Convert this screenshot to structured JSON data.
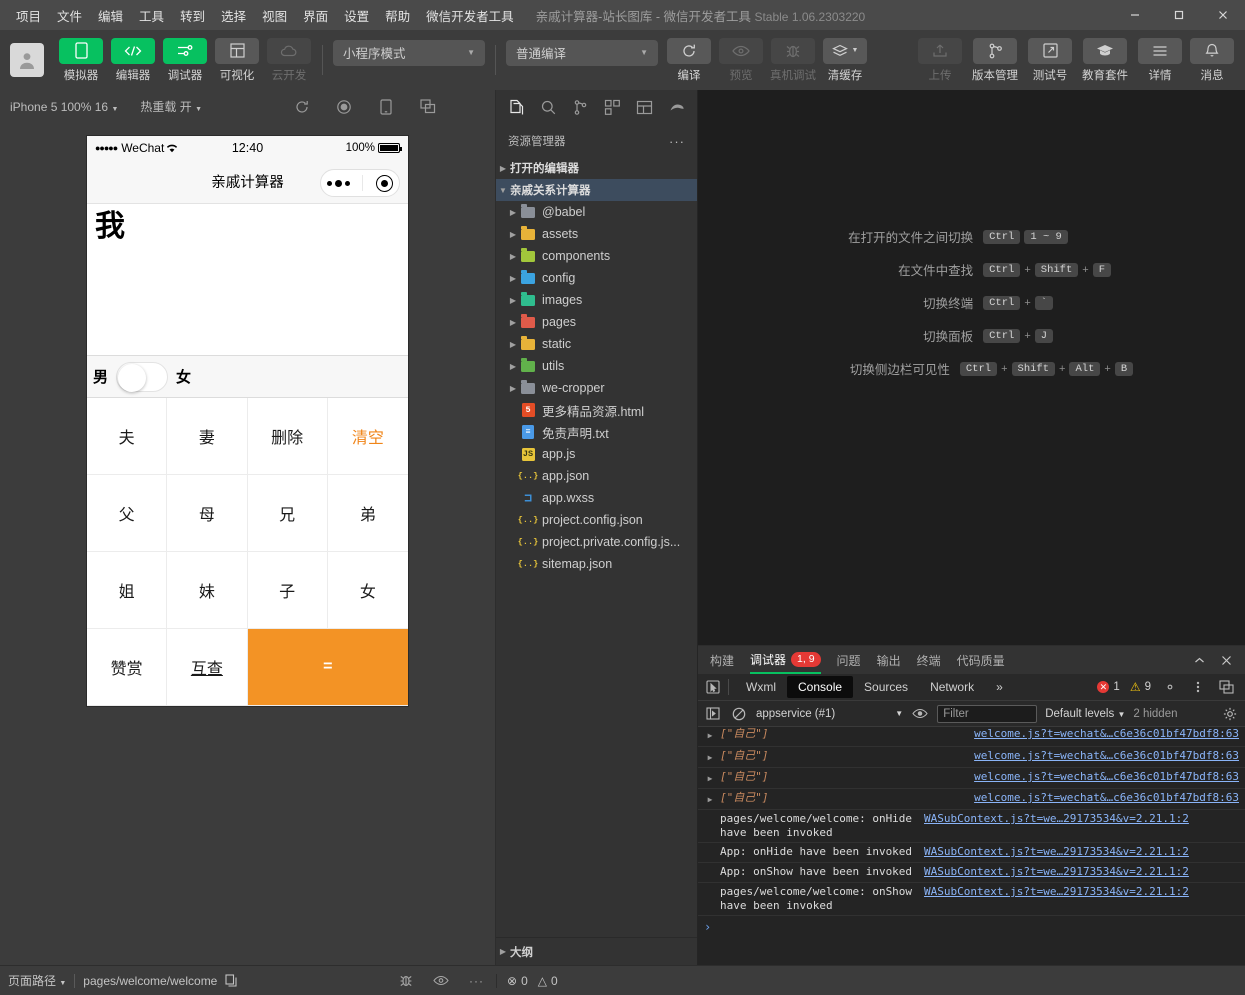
{
  "titlebar": {
    "menus": [
      "项目",
      "文件",
      "编辑",
      "工具",
      "转到",
      "选择",
      "视图",
      "界面",
      "设置",
      "帮助",
      "微信开发者工具"
    ],
    "document_title": "亲戚计算器-站长图库",
    "separator": " - ",
    "app_name": "微信开发者工具",
    "version": "Stable 1.06.2303220",
    "minimize": "—",
    "maximize": "▢",
    "close": "✕"
  },
  "toolbar": {
    "left_buttons": [
      {
        "label": "模拟器",
        "icon": "phone-icon",
        "state": "active"
      },
      {
        "label": "编辑器",
        "icon": "code-icon",
        "state": "active"
      },
      {
        "label": "调试器",
        "icon": "sliders-icon",
        "state": "active"
      },
      {
        "label": "可视化",
        "icon": "layout-icon",
        "state": "normal"
      },
      {
        "label": "云开发",
        "icon": "cloud-icon",
        "state": "disabled"
      }
    ],
    "mode_select": "小程序模式",
    "compile_select": "普通编译",
    "mid_buttons": [
      {
        "label": "编译",
        "icon": "refresh-icon",
        "state": "normal"
      },
      {
        "label": "预览",
        "icon": "eye-icon",
        "state": "disabled"
      },
      {
        "label": "真机调试",
        "icon": "bug-icon",
        "state": "disabled"
      },
      {
        "label": "清缓存",
        "icon": "layers-icon",
        "state": "normal"
      }
    ],
    "right_buttons": [
      {
        "label": "上传",
        "icon": "upload-icon",
        "state": "disabled"
      },
      {
        "label": "版本管理",
        "icon": "branch-icon",
        "state": "normal"
      },
      {
        "label": "测试号",
        "icon": "external-icon",
        "state": "normal"
      },
      {
        "label": "教育套件",
        "icon": "graduation-icon",
        "state": "normal"
      },
      {
        "label": "详情",
        "icon": "menu-icon",
        "state": "normal"
      },
      {
        "label": "消息",
        "icon": "bell-icon",
        "state": "normal"
      }
    ]
  },
  "simulator": {
    "device_select": "iPhone 5 100% 16",
    "hotreload_label": "热重载 开",
    "icons": [
      "rotate-icon",
      "record-icon",
      "device-icon",
      "popout-icon"
    ],
    "phone": {
      "status": {
        "dots": "●●●●●",
        "carrier": "WeChat",
        "wifi": "⌃",
        "time": "12:40",
        "battery_pct": "100%"
      },
      "nav_title": "亲戚计算器",
      "capsule": {
        "more": "•••",
        "target": "◉"
      },
      "expression": "我",
      "gender": {
        "male": "男",
        "female": "女",
        "value": "male"
      },
      "keys": [
        {
          "label": "夫",
          "style": "normal"
        },
        {
          "label": "妻",
          "style": "normal"
        },
        {
          "label": "删除",
          "style": "normal"
        },
        {
          "label": "清空",
          "style": "orange-text"
        },
        {
          "label": "父",
          "style": "normal"
        },
        {
          "label": "母",
          "style": "normal"
        },
        {
          "label": "兄",
          "style": "normal"
        },
        {
          "label": "弟",
          "style": "normal"
        },
        {
          "label": "姐",
          "style": "normal"
        },
        {
          "label": "妹",
          "style": "normal"
        },
        {
          "label": "子",
          "style": "normal"
        },
        {
          "label": "女",
          "style": "normal"
        },
        {
          "label": "赞赏",
          "style": "normal"
        },
        {
          "label": "互查",
          "style": "underline"
        },
        {
          "label": "=",
          "style": "equals"
        }
      ]
    }
  },
  "explorer": {
    "tabs": [
      "files-icon",
      "search-icon",
      "scm-icon",
      "extensions-icon",
      "debug-icon",
      "plugin-icon"
    ],
    "title": "资源管理器",
    "more": "···",
    "sections": [
      {
        "label": "打开的编辑器",
        "expanded": false
      },
      {
        "label": "亲戚关系计算器",
        "expanded": true,
        "highlight": true
      }
    ],
    "tree": [
      {
        "name": "@babel",
        "type": "folder",
        "color": "#8a8f98",
        "expandable": true
      },
      {
        "name": "assets",
        "type": "folder",
        "color": "#e8b339",
        "expandable": true
      },
      {
        "name": "components",
        "type": "folder",
        "color": "#a2c73b",
        "expandable": true
      },
      {
        "name": "config",
        "type": "folder",
        "color": "#3ba3e0",
        "expandable": true
      },
      {
        "name": "images",
        "type": "folder",
        "color": "#2fbd8e",
        "expandable": true
      },
      {
        "name": "pages",
        "type": "folder",
        "color": "#e05b4a",
        "expandable": true
      },
      {
        "name": "static",
        "type": "folder",
        "color": "#e8b339",
        "expandable": true
      },
      {
        "name": "utils",
        "type": "folder",
        "color": "#61b14b",
        "expandable": true
      },
      {
        "name": "we-cropper",
        "type": "folder",
        "color": "#8a8f98",
        "expandable": true
      },
      {
        "name": "更多精品资源.html",
        "type": "html",
        "color": "#e44d26",
        "icon_text": "5"
      },
      {
        "name": "免责声明.txt",
        "type": "txt",
        "color": "#4a9ae8",
        "icon_text": "≡"
      },
      {
        "name": "app.js",
        "type": "js",
        "color": "#e8c53a",
        "icon_text": "JS"
      },
      {
        "name": "app.json",
        "type": "json",
        "color": "#e8c53a",
        "icon_text": "{..}"
      },
      {
        "name": "app.wxss",
        "type": "wxss",
        "color": "#3d8fd6",
        "icon_text": "⌐"
      },
      {
        "name": "project.config.json",
        "type": "json",
        "color": "#e8c53a",
        "icon_text": "{..}"
      },
      {
        "name": "project.private.config.js...",
        "type": "json",
        "color": "#e8c53a",
        "icon_text": "{..}"
      },
      {
        "name": "sitemap.json",
        "type": "json",
        "color": "#e8c53a",
        "icon_text": "{..}"
      }
    ],
    "outline": "大纲"
  },
  "editor": {
    "shortcuts": [
      {
        "label": "在打开的文件之间切换",
        "keys": [
          "Ctrl",
          "1 ~ 9"
        ],
        "seps": [
          ""
        ]
      },
      {
        "label": "在文件中查找",
        "keys": [
          "Ctrl",
          "Shift",
          "F"
        ],
        "seps": [
          "+",
          "+"
        ]
      },
      {
        "label": "切换终端",
        "keys": [
          "Ctrl",
          "`"
        ],
        "seps": [
          "+"
        ]
      },
      {
        "label": "切换面板",
        "keys": [
          "Ctrl",
          "J"
        ],
        "seps": [
          "+"
        ]
      },
      {
        "label": "切换侧边栏可见性",
        "keys": [
          "Ctrl",
          "Shift",
          "Alt",
          "B"
        ],
        "seps": [
          "+",
          "+",
          "+"
        ]
      }
    ]
  },
  "debugger": {
    "panel_tabs": [
      {
        "label": "构建",
        "active": false
      },
      {
        "label": "调试器",
        "active": true,
        "badge": "1, 9"
      },
      {
        "label": "问题",
        "active": false
      },
      {
        "label": "输出",
        "active": false
      },
      {
        "label": "终端",
        "active": false
      },
      {
        "label": "代码质量",
        "active": false
      }
    ],
    "collapse_icon": "chevron-up-icon",
    "close_icon": "close-icon",
    "devtools_tabs": [
      {
        "label": "Wxml",
        "active": false
      },
      {
        "label": "Console",
        "active": true
      },
      {
        "label": "Sources",
        "active": false
      },
      {
        "label": "Network",
        "active": false
      },
      {
        "label": "»",
        "active": false
      }
    ],
    "inspect_icon": "inspect-icon",
    "error_count": "1",
    "warning_count": "9",
    "settings_icon": "gear-icon",
    "kebab_icon": "kebab-icon",
    "dock_icon": "dock-icon",
    "console_bar": {
      "sidebar_icon": "console-sidebar-icon",
      "clear_icon": "clear-icon",
      "context": "appservice (#1)",
      "eye_icon": "eye-icon",
      "filter_placeholder": "Filter",
      "levels": "Default levels",
      "hidden": "2 hidden",
      "settings_icon": "gear-icon"
    },
    "logs": [
      {
        "kind": "array",
        "text": "[\"自己\"]",
        "source": "welcome.js?t=wechat&…c6e36c01bf47bdf8:63"
      },
      {
        "kind": "array",
        "text": "[\"自己\"]",
        "source": "welcome.js?t=wechat&…c6e36c01bf47bdf8:63"
      },
      {
        "kind": "array",
        "text": "[\"自己\"]",
        "source": "welcome.js?t=wechat&…c6e36c01bf47bdf8:63"
      },
      {
        "kind": "text",
        "text": "pages/welcome/welcome: onHide have been invoked",
        "source": "WASubContext.js?t=we…29173534&v=2.21.1:2"
      },
      {
        "kind": "text",
        "text": "App: onHide have been invoked",
        "source": "WASubContext.js?t=we…29173534&v=2.21.1:2"
      },
      {
        "kind": "text",
        "text": "App: onShow have been invoked",
        "source": "WASubContext.js?t=we…29173534&v=2.21.1:2"
      },
      {
        "kind": "text",
        "text": "pages/welcome/welcome: onShow have been invoked",
        "source": "WASubContext.js?t=we…29173534&v=2.21.1:2"
      }
    ],
    "prompt": "›"
  },
  "statusbar": {
    "page_path_label": "页面路径",
    "page_path_value": "pages/welcome/welcome",
    "copy_icon": "copy-icon",
    "icons": [
      "bug-icon",
      "eye-icon",
      "more-icon"
    ],
    "problems_errors": "0",
    "problems_warnings": "0"
  },
  "colors": {
    "accent_green": "#07c160",
    "key_orange": "#f39325",
    "clear_orange": "#f08519",
    "error_red": "#e53935",
    "link_blue": "#8ab4f8"
  }
}
